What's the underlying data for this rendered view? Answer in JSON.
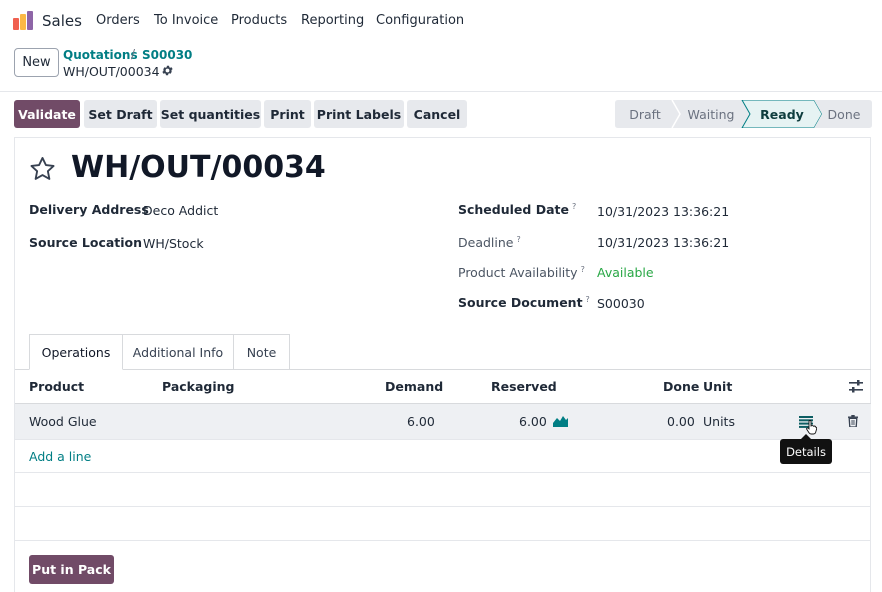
{
  "navbar": {
    "app_name": "Sales",
    "menu": [
      "Orders",
      "To Invoice",
      "Products",
      "Reporting",
      "Configuration"
    ]
  },
  "breadcrumb": {
    "new_label": "New",
    "parents": [
      "Quotations",
      "S00030"
    ],
    "separator": "/",
    "current": "WH/OUT/00034"
  },
  "actions": [
    "Validate",
    "Set Draft",
    "Set quantities",
    "Print",
    "Print Labels",
    "Cancel"
  ],
  "statusbar": {
    "stages": [
      "Draft",
      "Waiting",
      "Ready",
      "Done"
    ],
    "active": "Ready"
  },
  "record": {
    "title": "WH/OUT/00034",
    "delivery_address_label": "Delivery Address",
    "delivery_address": "Deco Addict",
    "source_location_label": "Source Location",
    "source_location": "WH/Stock",
    "scheduled_date_label": "Scheduled Date",
    "scheduled_date": "10/31/2023 13:36:21",
    "deadline_label": "Deadline",
    "deadline": "10/31/2023 13:36:21",
    "availability_label": "Product Availability",
    "availability": "Available",
    "source_document_label": "Source Document",
    "source_document": "S00030",
    "help_mark": "?"
  },
  "tabs": [
    "Operations",
    "Additional Info",
    "Note"
  ],
  "table": {
    "headers": {
      "product": "Product",
      "packaging": "Packaging",
      "demand": "Demand",
      "reserved": "Reserved",
      "done": "Done",
      "unit": "Unit"
    },
    "rows": [
      {
        "product": "Wood Glue",
        "demand": "6.00",
        "reserved": "6.00",
        "done": "0.00",
        "unit": "Units"
      }
    ],
    "add_line": "Add a line"
  },
  "tooltip": "Details",
  "footer": {
    "put_in_pack": "Put in Pack"
  },
  "colors": {
    "primary": "#714b67",
    "link": "#017e84",
    "available": "#28a745"
  }
}
